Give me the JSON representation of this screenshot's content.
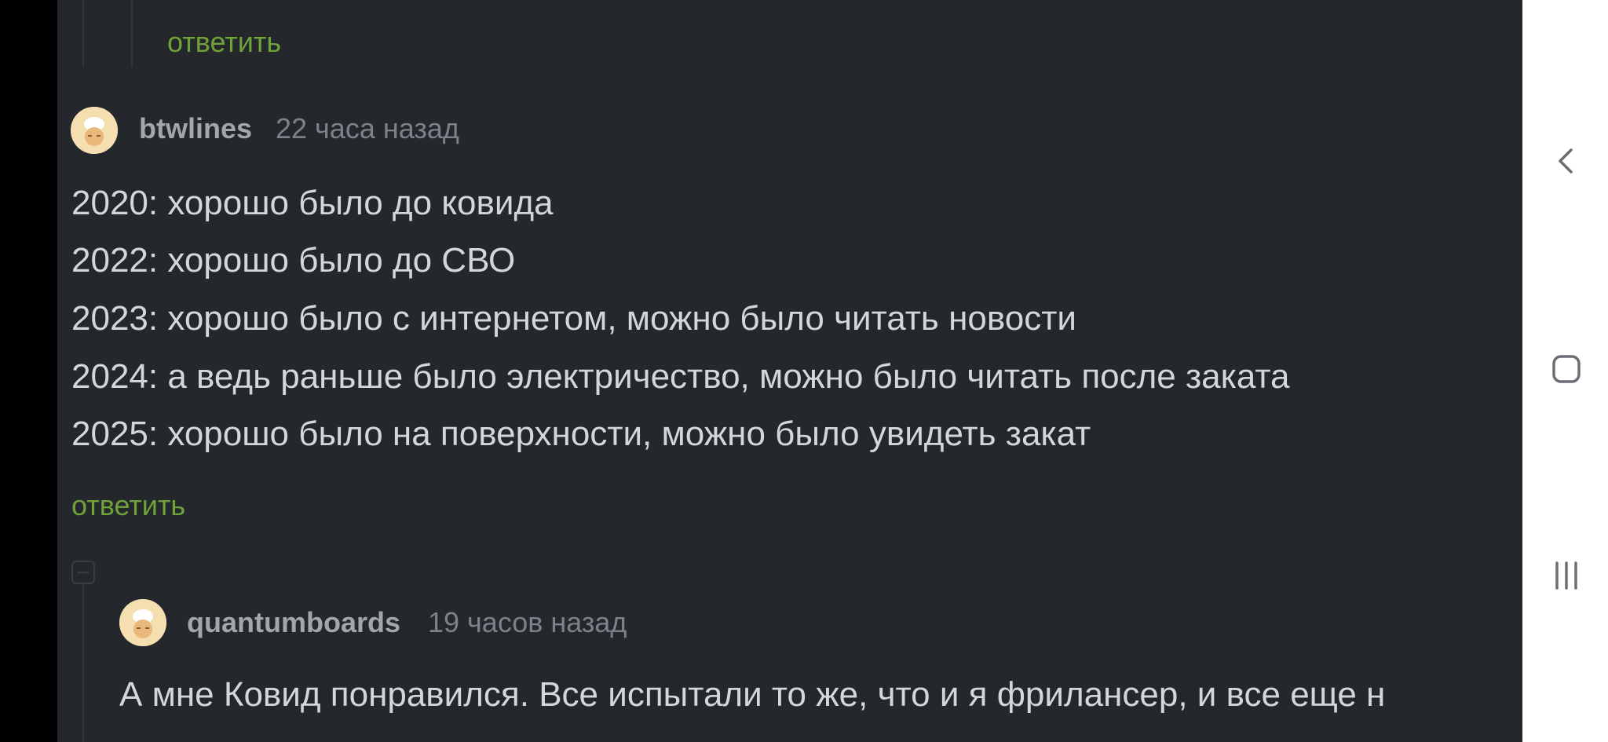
{
  "thread": {
    "top_reply_label": "ответить",
    "comments": [
      {
        "username": "btwlines",
        "time": "22 часа назад",
        "lines": [
          "2020: хорошо было до ковида",
          "2022: хорошо было до СВО",
          "2023: хорошо было с интернетом, можно было читать новости",
          "2024: а ведь раньше было электричество, можно было читать после заката",
          "2025: хорошо было на поверхности, можно было увидеть закат"
        ],
        "reply_label": "ответить"
      },
      {
        "username": "quantumboards",
        "time": "19 часов назад",
        "lines": [
          "А мне Ковид понравился. Все испытали то же, что и я фрилансер, и все еще н"
        ]
      }
    ]
  },
  "colors": {
    "background": "#24272b",
    "reply_link": "#6fa33a",
    "text": "#d4d6d9",
    "username": "#a3a7ad",
    "timestamp": "#7d828a"
  },
  "navbar": {
    "icons": [
      "back-icon",
      "home-icon",
      "recent-apps-icon"
    ]
  }
}
